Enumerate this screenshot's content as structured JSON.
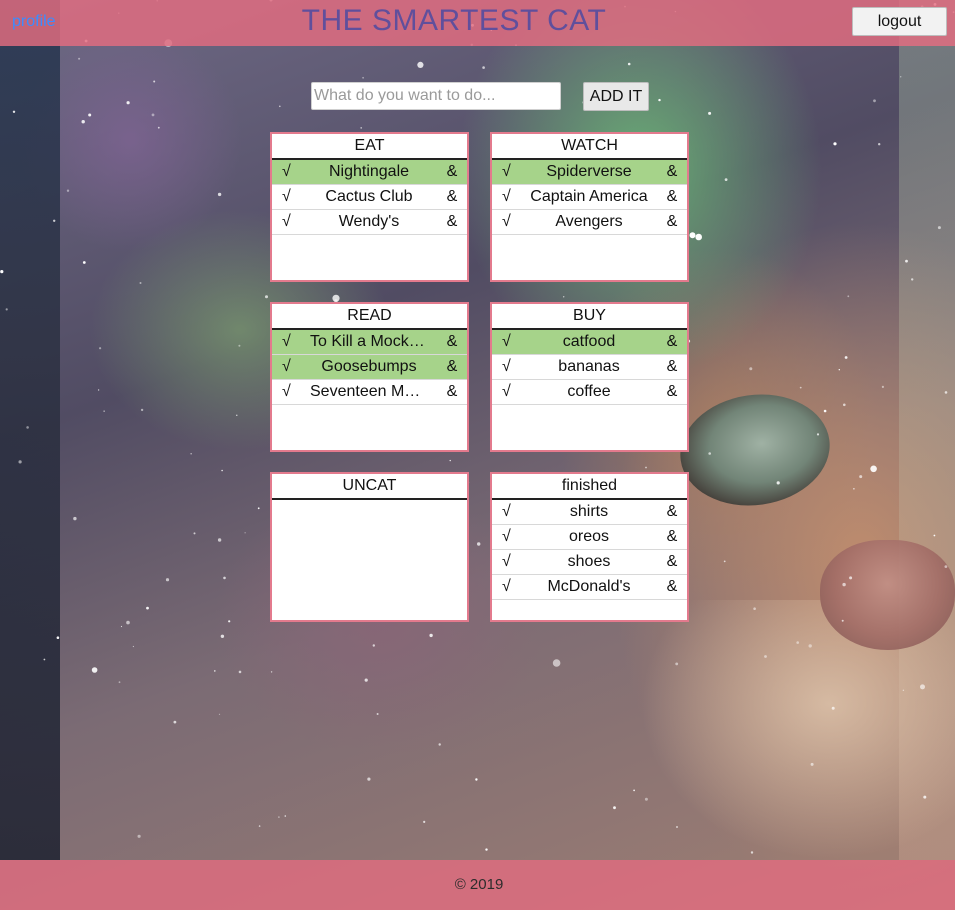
{
  "header": {
    "profile_label": "profile",
    "title": "THE SMARTEST CAT",
    "logout_label": "logout"
  },
  "add_form": {
    "placeholder": "What do you want to do...",
    "value": "",
    "button_label": "ADD IT"
  },
  "icons": {
    "check_mark": "√",
    "ampersand": "&"
  },
  "colors": {
    "accent_pink": "#e37a8d",
    "title_purple": "#604f9c",
    "done_green": "#a6d38a",
    "link_blue": "#3b8cff"
  },
  "categories": [
    {
      "title": "EAT",
      "items": [
        {
          "text": "Nightingale",
          "done": true
        },
        {
          "text": "Cactus Club",
          "done": false
        },
        {
          "text": "Wendy's",
          "done": false
        }
      ]
    },
    {
      "title": "WATCH",
      "items": [
        {
          "text": "Spiderverse",
          "done": true
        },
        {
          "text": "Captain America",
          "done": false
        },
        {
          "text": "Avengers",
          "done": false
        }
      ]
    },
    {
      "title": "READ",
      "items": [
        {
          "text": "To Kill a Mockingbird",
          "done": true
        },
        {
          "text": "Goosebumps",
          "done": true
        },
        {
          "text": "Seventeen Magazine",
          "done": false
        }
      ]
    },
    {
      "title": "BUY",
      "items": [
        {
          "text": "catfood",
          "done": true
        },
        {
          "text": "bananas",
          "done": false
        },
        {
          "text": "coffee",
          "done": false
        }
      ]
    },
    {
      "title": "UNCAT",
      "items": []
    },
    {
      "title": "finished",
      "items": [
        {
          "text": "shirts",
          "done": false
        },
        {
          "text": "oreos",
          "done": false
        },
        {
          "text": "shoes",
          "done": false
        },
        {
          "text": "McDonald's",
          "done": false
        }
      ]
    }
  ],
  "footer": {
    "copyright": "© 2019"
  }
}
